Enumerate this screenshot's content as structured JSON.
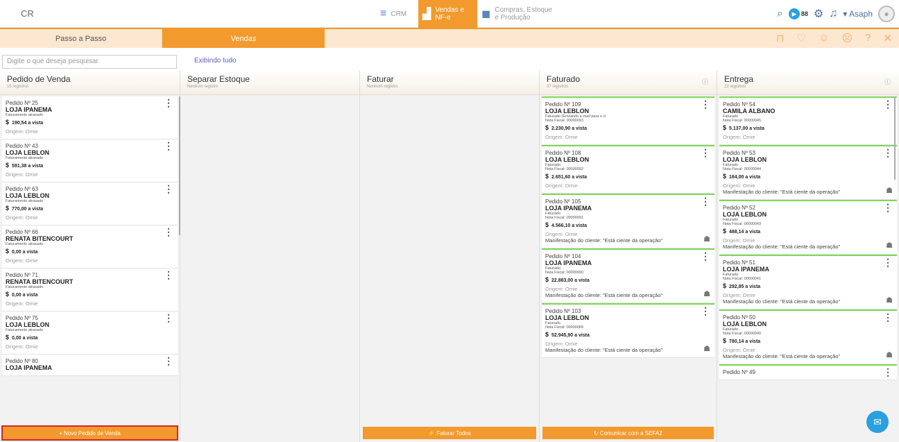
{
  "header": {
    "logo": "CR",
    "modules": [
      {
        "label": "CRM",
        "icon": "crm-icon"
      },
      {
        "label_line1": "Vendas e",
        "label_line2": "NF-e",
        "icon": "chart-icon"
      },
      {
        "label_line1": "Compras, Estoque",
        "label_line2": "e Produção",
        "icon": "box-icon"
      }
    ],
    "user": "Asaph",
    "qr_label": "88"
  },
  "tabs": {
    "passo": "Passo a Passo",
    "vendas": "Vendas"
  },
  "search": {
    "placeholder": "Digite o que deseja pesquisar",
    "showing": "Exibindo tudo"
  },
  "columns": [
    {
      "title": "Pedido de Venda",
      "sub": "15 registros",
      "footer": "+ Novo Pedido de Venda",
      "cards": [
        {
          "num": "Pedido Nº 25",
          "cli": "LOJA IPANEMA",
          "st": "Faturamento atrasado",
          "val": "190,54 a vista",
          "ori": "Origem: Omie"
        },
        {
          "num": "Pedido Nº 43",
          "cli": "LOJA LEBLON",
          "st": "Faturamento atrasado",
          "val": "591,38 a vista",
          "ori": "Origem: Omie"
        },
        {
          "num": "Pedido Nº 63",
          "cli": "LOJA LEBLON",
          "st": "Faturamento atrasado",
          "val": "770,00 a vista",
          "ori": "Origem: Omie"
        },
        {
          "num": "Pedido Nº 66",
          "cli": "RENATA BITENCOURT",
          "st": "Faturamento atrasado",
          "val": "0,00 a vista",
          "ori": "Origem: Omie"
        },
        {
          "num": "Pedido Nº 71",
          "cli": "RENATA BITENCOURT",
          "st": "Faturamento atrasado",
          "val": "0,00 a vista",
          "ori": "Origem: Omie"
        },
        {
          "num": "Pedido Nº 75",
          "cli": "LOJA LEBLON",
          "st": "Faturamento atrasado",
          "val": "0,00 a vista",
          "ori": "Origem: Omie"
        },
        {
          "num": "Pedido Nº 80",
          "cli": "LOJA IPANEMA",
          "st": "",
          "val": "",
          "ori": ""
        }
      ]
    },
    {
      "title": "Separar Estoque",
      "sub": "Nenhum registro"
    },
    {
      "title": "Faturar",
      "sub": "Nenhum registro",
      "footer": "⚡ Faturar Todos"
    },
    {
      "title": "Faturado",
      "sub": "37 registros",
      "footer": "↻ Comunicar com a SEFAZ",
      "cards": [
        {
          "num": "Pedido Nº 109",
          "cli": "LOJA LEBLON",
          "st": "Faturado (Enviando e-mail para o cl",
          "nf": "Nota Fiscal: 00000093",
          "val": "2.230,90 a vista",
          "ori": "Origem: Omie",
          "man": ""
        },
        {
          "num": "Pedido Nº 108",
          "cli": "LOJA LEBLON",
          "st": "Faturado",
          "nf": "Nota Fiscal: 00000092",
          "val": "2.651,60 a vista",
          "ori": "Origem: Omie",
          "man": ""
        },
        {
          "num": "Pedido Nº 105",
          "cli": "LOJA IPANEMA",
          "st": "Faturado",
          "nf": "Nota Fiscal: 00000091",
          "val": "4.566,10 a vista",
          "ori": "Origem: Omie",
          "man": "Manifestação do cliente: \"Está ciente da operação\""
        },
        {
          "num": "Pedido Nº 104",
          "cli": "LOJA IPANEMA",
          "st": "Faturado",
          "nf": "Nota Fiscal: 00000090",
          "val": "22.883,00 a vista",
          "ori": "Origem: Omie",
          "man": "Manifestação do cliente: \"Está ciente da operação\""
        },
        {
          "num": "Pedido Nº 103",
          "cli": "LOJA LEBLON",
          "st": "Faturado",
          "nf": "Nota Fiscal: 00000089",
          "val": "52.945,90 a vista",
          "ori": "Origem: Omie",
          "man": "Manifestação do cliente: \"Está ciente da operação\""
        }
      ]
    },
    {
      "title": "Entrega",
      "sub": "22 registros",
      "cards": [
        {
          "num": "Pedido Nº 54",
          "cli": "CAMILA ALBANO",
          "st": "Faturado",
          "nf": "Nota Fiscal: 00000045",
          "val": "5.137,00 a vista",
          "ori": "Origem: Omie",
          "man": ""
        },
        {
          "num": "Pedido Nº 53",
          "cli": "LOJA LEBLON",
          "st": "Faturado",
          "nf": "Nota Fiscal: 00000044",
          "val": "164,00 a vista",
          "ori": "Origem: Omie",
          "man": "Manifestação do cliente: \"Está ciente da operação\""
        },
        {
          "num": "Pedido Nº 52",
          "cli": "LOJA LEBLON",
          "st": "Faturado",
          "nf": "Nota Fiscal: 00000043",
          "val": "488,14 a vista",
          "ori": "Origem: Omie",
          "man": "Manifestação do cliente: \"Está ciente da operação\""
        },
        {
          "num": "Pedido Nº 51",
          "cli": "LOJA IPANEMA",
          "st": "Faturado",
          "nf": "Nota Fiscal: 00000041",
          "val": "292,85 a vista",
          "ori": "Origem: Omie",
          "man": "Manifestação do cliente: \"Está ciente da operação\""
        },
        {
          "num": "Pedido Nº 50",
          "cli": "LOJA LEBLON",
          "st": "Faturado",
          "nf": "Nota Fiscal: 00000040",
          "val": "780,14 a vista",
          "ori": "Origem: Omie",
          "man": "Manifestação do cliente: \"Está ciente da operação\""
        },
        {
          "num": "Pedido Nº 49",
          "cli": "",
          "st": "",
          "nf": "",
          "val": "",
          "ori": "",
          "man": ""
        }
      ]
    }
  ],
  "watermark": "omie",
  "colors": {
    "accent": "#f29a2e",
    "highlight": "#d9232d",
    "green": "#7ed957"
  }
}
